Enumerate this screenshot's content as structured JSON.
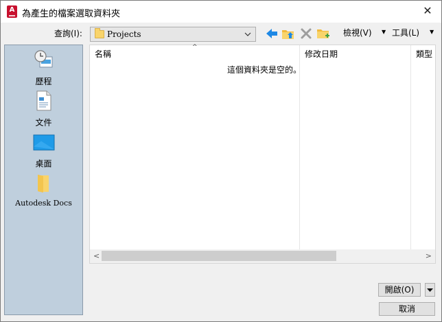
{
  "window": {
    "title": "為產生的檔案選取資料夾",
    "close_glyph": "✕",
    "app_icon_letter": "A"
  },
  "lookin": {
    "label": "查詢(I):",
    "value": "Projects"
  },
  "toolbar": {
    "views_label": "檢視(V)",
    "tools_label": "工具(L)",
    "dropdown_glyph": "▼"
  },
  "places": [
    {
      "label": "歷程",
      "icon": "history-icon"
    },
    {
      "label": "文件",
      "icon": "documents-icon"
    },
    {
      "label": "桌面",
      "icon": "desktop-icon"
    },
    {
      "label": "Autodesk Docs",
      "icon": "folder-icon"
    }
  ],
  "filelist": {
    "columns": [
      "名稱",
      "修改日期",
      "類型"
    ],
    "sort_glyph": "^",
    "empty_message": "這個資料夾是空的。"
  },
  "scrollbar": {
    "left_glyph": "<",
    "right_glyph": ">"
  },
  "buttons": {
    "open": "開啟(O)",
    "cancel": "取消"
  },
  "colors": {
    "places_bg": "#bfcfdd",
    "accent_blue": "#1e88e5",
    "folder_yellow": "#f9d46b",
    "brand_red": "#c8102e"
  }
}
